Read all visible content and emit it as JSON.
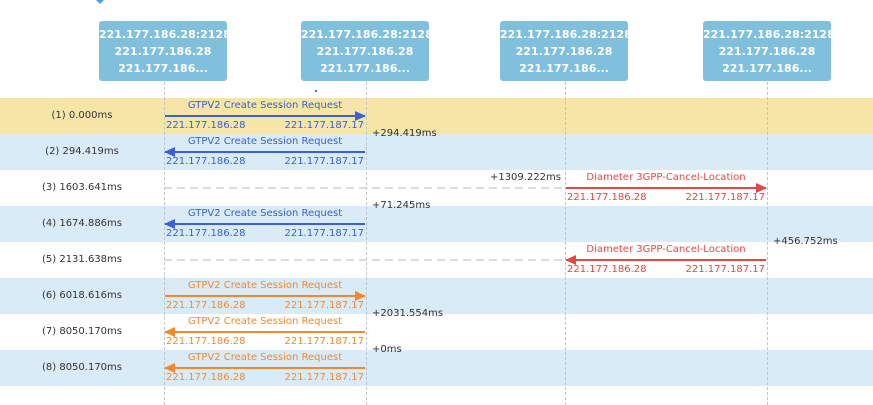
{
  "nodes": [
    {
      "line1": "221.177.186.28:2128",
      "line2": "221.177.186.28",
      "line3": "221.177.186..."
    },
    {
      "line1": "221.177.186.28:2128",
      "line2": "221.177.186.28",
      "line3": "221.177.186..."
    },
    {
      "line1": "221.177.186.28:2128",
      "line2": "221.177.186.28",
      "line3": "221.177.186..."
    },
    {
      "line1": "221.177.186.28:2128",
      "line2": "221.177.186.28",
      "line3": "221.177.186..."
    }
  ],
  "messages": [
    {
      "label": "(1) 0.000ms",
      "title": "GTPV2 Create Session Request",
      "src_ip": "221.177.186.28",
      "dst_ip": "221.177.187.17",
      "from": 0,
      "to": 1,
      "color": "#3a5fd6",
      "delta": "",
      "row_bg": "#f5e6a8"
    },
    {
      "label": "(2) 294.419ms",
      "title": "GTPV2 Create Session Request",
      "src_ip": "221.177.186.28",
      "dst_ip": "221.177.187.17",
      "from": 1,
      "to": 0,
      "color": "#3a5fd6",
      "delta": "+294.419ms",
      "row_bg": "#d9ebf7"
    },
    {
      "label": "(3) 1603.641ms",
      "title": "Diameter 3GPP-Cancel-Location",
      "src_ip": "221.177.186.28",
      "dst_ip": "221.177.187.17",
      "from": 2,
      "to": 3,
      "color": "#e04848",
      "delta": "+1309.222ms",
      "row_bg": "#ffffff"
    },
    {
      "label": "(4) 1674.886ms",
      "title": "GTPV2 Create Session Request",
      "src_ip": "221.177.186.28",
      "dst_ip": "221.177.187.17",
      "from": 1,
      "to": 0,
      "color": "#3a5fd6",
      "delta": "+71.245ms",
      "row_bg": "#d9ebf7"
    },
    {
      "label": "(5) 2131.638ms",
      "title": "Diameter 3GPP-Cancel-Location",
      "src_ip": "221.177.186.28",
      "dst_ip": "221.177.187.17",
      "from": 3,
      "to": 2,
      "color": "#e04848",
      "delta": "+456.752ms",
      "row_bg": "#ffffff"
    },
    {
      "label": "(6) 6018.616ms",
      "title": "GTPV2 Create Session Request",
      "src_ip": "221.177.186.28",
      "dst_ip": "221.177.187.17",
      "from": 0,
      "to": 1,
      "color": "#f08a30",
      "delta": "",
      "row_bg": "#d9ebf7"
    },
    {
      "label": "(7) 8050.170ms",
      "title": "GTPV2 Create Session Request",
      "src_ip": "221.177.186.28",
      "dst_ip": "221.177.187.17",
      "from": 1,
      "to": 0,
      "color": "#f08a30",
      "delta": "+2031.554ms",
      "row_bg": "#ffffff"
    },
    {
      "label": "(8) 8050.170ms",
      "title": "GTPV2 Create Session Request",
      "src_ip": "221.177.186.28",
      "dst_ip": "221.177.187.17",
      "from": 1,
      "to": 0,
      "color": "#f08a30",
      "delta": "+0ms",
      "row_bg": "#d9ebf7"
    }
  ]
}
